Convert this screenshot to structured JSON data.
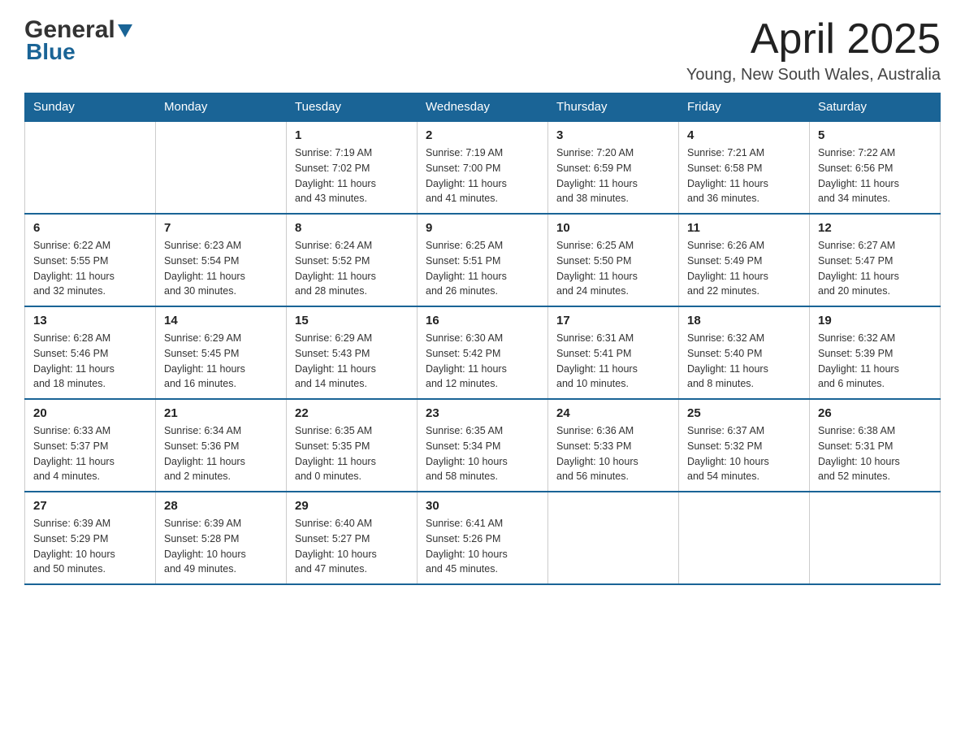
{
  "logo": {
    "general": "General",
    "blue": "Blue"
  },
  "title": "April 2025",
  "location": "Young, New South Wales, Australia",
  "days_of_week": [
    "Sunday",
    "Monday",
    "Tuesday",
    "Wednesday",
    "Thursday",
    "Friday",
    "Saturday"
  ],
  "weeks": [
    [
      {
        "day": "",
        "info": ""
      },
      {
        "day": "",
        "info": ""
      },
      {
        "day": "1",
        "info": "Sunrise: 7:19 AM\nSunset: 7:02 PM\nDaylight: 11 hours\nand 43 minutes."
      },
      {
        "day": "2",
        "info": "Sunrise: 7:19 AM\nSunset: 7:00 PM\nDaylight: 11 hours\nand 41 minutes."
      },
      {
        "day": "3",
        "info": "Sunrise: 7:20 AM\nSunset: 6:59 PM\nDaylight: 11 hours\nand 38 minutes."
      },
      {
        "day": "4",
        "info": "Sunrise: 7:21 AM\nSunset: 6:58 PM\nDaylight: 11 hours\nand 36 minutes."
      },
      {
        "day": "5",
        "info": "Sunrise: 7:22 AM\nSunset: 6:56 PM\nDaylight: 11 hours\nand 34 minutes."
      }
    ],
    [
      {
        "day": "6",
        "info": "Sunrise: 6:22 AM\nSunset: 5:55 PM\nDaylight: 11 hours\nand 32 minutes."
      },
      {
        "day": "7",
        "info": "Sunrise: 6:23 AM\nSunset: 5:54 PM\nDaylight: 11 hours\nand 30 minutes."
      },
      {
        "day": "8",
        "info": "Sunrise: 6:24 AM\nSunset: 5:52 PM\nDaylight: 11 hours\nand 28 minutes."
      },
      {
        "day": "9",
        "info": "Sunrise: 6:25 AM\nSunset: 5:51 PM\nDaylight: 11 hours\nand 26 minutes."
      },
      {
        "day": "10",
        "info": "Sunrise: 6:25 AM\nSunset: 5:50 PM\nDaylight: 11 hours\nand 24 minutes."
      },
      {
        "day": "11",
        "info": "Sunrise: 6:26 AM\nSunset: 5:49 PM\nDaylight: 11 hours\nand 22 minutes."
      },
      {
        "day": "12",
        "info": "Sunrise: 6:27 AM\nSunset: 5:47 PM\nDaylight: 11 hours\nand 20 minutes."
      }
    ],
    [
      {
        "day": "13",
        "info": "Sunrise: 6:28 AM\nSunset: 5:46 PM\nDaylight: 11 hours\nand 18 minutes."
      },
      {
        "day": "14",
        "info": "Sunrise: 6:29 AM\nSunset: 5:45 PM\nDaylight: 11 hours\nand 16 minutes."
      },
      {
        "day": "15",
        "info": "Sunrise: 6:29 AM\nSunset: 5:43 PM\nDaylight: 11 hours\nand 14 minutes."
      },
      {
        "day": "16",
        "info": "Sunrise: 6:30 AM\nSunset: 5:42 PM\nDaylight: 11 hours\nand 12 minutes."
      },
      {
        "day": "17",
        "info": "Sunrise: 6:31 AM\nSunset: 5:41 PM\nDaylight: 11 hours\nand 10 minutes."
      },
      {
        "day": "18",
        "info": "Sunrise: 6:32 AM\nSunset: 5:40 PM\nDaylight: 11 hours\nand 8 minutes."
      },
      {
        "day": "19",
        "info": "Sunrise: 6:32 AM\nSunset: 5:39 PM\nDaylight: 11 hours\nand 6 minutes."
      }
    ],
    [
      {
        "day": "20",
        "info": "Sunrise: 6:33 AM\nSunset: 5:37 PM\nDaylight: 11 hours\nand 4 minutes."
      },
      {
        "day": "21",
        "info": "Sunrise: 6:34 AM\nSunset: 5:36 PM\nDaylight: 11 hours\nand 2 minutes."
      },
      {
        "day": "22",
        "info": "Sunrise: 6:35 AM\nSunset: 5:35 PM\nDaylight: 11 hours\nand 0 minutes."
      },
      {
        "day": "23",
        "info": "Sunrise: 6:35 AM\nSunset: 5:34 PM\nDaylight: 10 hours\nand 58 minutes."
      },
      {
        "day": "24",
        "info": "Sunrise: 6:36 AM\nSunset: 5:33 PM\nDaylight: 10 hours\nand 56 minutes."
      },
      {
        "day": "25",
        "info": "Sunrise: 6:37 AM\nSunset: 5:32 PM\nDaylight: 10 hours\nand 54 minutes."
      },
      {
        "day": "26",
        "info": "Sunrise: 6:38 AM\nSunset: 5:31 PM\nDaylight: 10 hours\nand 52 minutes."
      }
    ],
    [
      {
        "day": "27",
        "info": "Sunrise: 6:39 AM\nSunset: 5:29 PM\nDaylight: 10 hours\nand 50 minutes."
      },
      {
        "day": "28",
        "info": "Sunrise: 6:39 AM\nSunset: 5:28 PM\nDaylight: 10 hours\nand 49 minutes."
      },
      {
        "day": "29",
        "info": "Sunrise: 6:40 AM\nSunset: 5:27 PM\nDaylight: 10 hours\nand 47 minutes."
      },
      {
        "day": "30",
        "info": "Sunrise: 6:41 AM\nSunset: 5:26 PM\nDaylight: 10 hours\nand 45 minutes."
      },
      {
        "day": "",
        "info": ""
      },
      {
        "day": "",
        "info": ""
      },
      {
        "day": "",
        "info": ""
      }
    ]
  ],
  "colors": {
    "header_bg": "#1a6496",
    "header_text": "#ffffff",
    "border": "#cccccc"
  }
}
